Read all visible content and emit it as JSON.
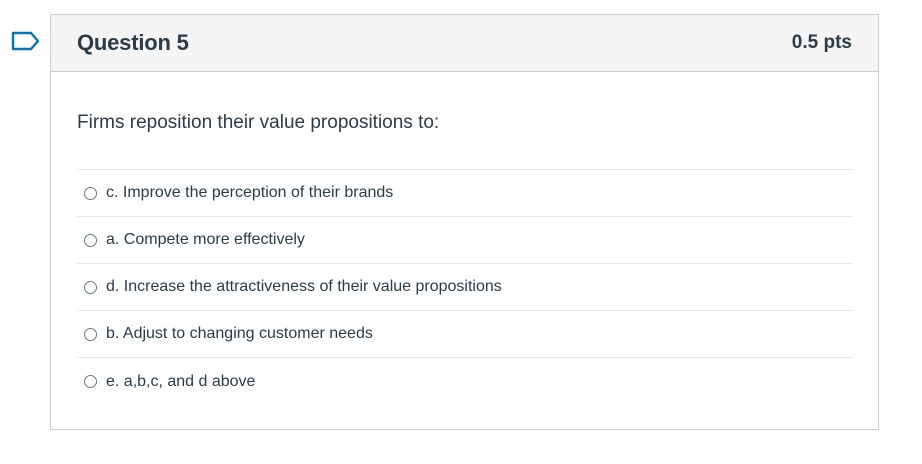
{
  "question": {
    "title": "Question 5",
    "points": "0.5 pts",
    "text": "Firms reposition their value propositions to:",
    "flag_icon": "bookmark-flag-icon",
    "accent_color": "#0374b5"
  },
  "answers": [
    {
      "label": "c. Improve the perception of their brands",
      "selected": false
    },
    {
      "label": "a. Compete more effectively",
      "selected": false
    },
    {
      "label": "d. Increase the attractiveness of their value propositions",
      "selected": false
    },
    {
      "label": "b. Adjust to changing customer needs",
      "selected": false
    },
    {
      "label": "e. a,b,c, and d above",
      "selected": false
    }
  ]
}
